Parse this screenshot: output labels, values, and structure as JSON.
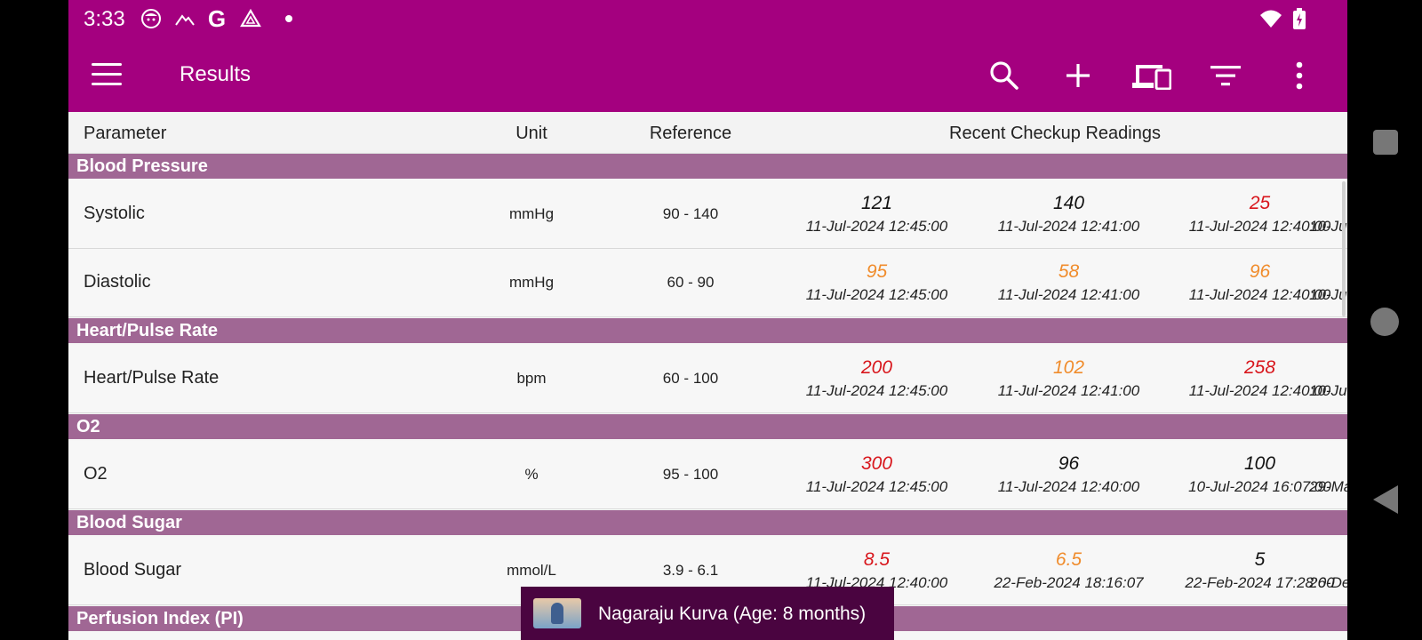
{
  "status": {
    "time": "3:33"
  },
  "toolbar": {
    "title": "Results"
  },
  "columns": {
    "parameter": "Parameter",
    "unit": "Unit",
    "reference": "Reference",
    "readings": "Recent Checkup Readings"
  },
  "sections": [
    {
      "name": "Blood Pressure"
    },
    {
      "name": "Heart/Pulse Rate"
    },
    {
      "name": "O2"
    },
    {
      "name": "Blood Sugar"
    },
    {
      "name": "Perfusion Index (PI)"
    }
  ],
  "rows": [
    {
      "param": "Systolic",
      "unit": "mmHg",
      "ref": "90 - 140",
      "readings": [
        {
          "value": "121",
          "date": "11-Jul-2024 12:45:00",
          "color": "#111111"
        },
        {
          "value": "140",
          "date": "11-Jul-2024 12:41:00",
          "color": "#111111"
        },
        {
          "value": "25",
          "date": "11-Jul-2024 12:40:00",
          "color": "#d8161c"
        },
        {
          "value": "",
          "date": "10-Ju",
          "color": "#111111"
        }
      ]
    },
    {
      "param": "Diastolic",
      "unit": "mmHg",
      "ref": "60 - 90",
      "readings": [
        {
          "value": "95",
          "date": "11-Jul-2024 12:45:00",
          "color": "#f08c2c"
        },
        {
          "value": "58",
          "date": "11-Jul-2024 12:41:00",
          "color": "#f08c2c"
        },
        {
          "value": "96",
          "date": "11-Jul-2024 12:40:00",
          "color": "#f08c2c"
        },
        {
          "value": "",
          "date": "10-Ju",
          "color": "#111111"
        }
      ]
    },
    {
      "param": "Heart/Pulse Rate",
      "unit": "bpm",
      "ref": "60 - 100",
      "readings": [
        {
          "value": "200",
          "date": "11-Jul-2024 12:45:00",
          "color": "#d8161c"
        },
        {
          "value": "102",
          "date": "11-Jul-2024 12:41:00",
          "color": "#f08c2c"
        },
        {
          "value": "258",
          "date": "11-Jul-2024 12:40:00",
          "color": "#d8161c"
        },
        {
          "value": "",
          "date": "10-Ju",
          "color": "#111111"
        }
      ]
    },
    {
      "param": "O2",
      "unit": "%",
      "ref": "95 - 100",
      "readings": [
        {
          "value": "300",
          "date": "11-Jul-2024 12:45:00",
          "color": "#d8161c"
        },
        {
          "value": "96",
          "date": "11-Jul-2024 12:40:00",
          "color": "#111111"
        },
        {
          "value": "100",
          "date": "10-Jul-2024 16:07:00",
          "color": "#111111"
        },
        {
          "value": "",
          "date": "29-Ma",
          "color": "#111111"
        }
      ]
    },
    {
      "param": "Blood Sugar",
      "unit": "mmol/L",
      "ref": "3.9 - 6.1",
      "readings": [
        {
          "value": "8.5",
          "date": "11-Jul-2024 12:40:00",
          "color": "#d8161c"
        },
        {
          "value": "6.5",
          "date": "22-Feb-2024 18:16:07",
          "color": "#f08c2c"
        },
        {
          "value": "5",
          "date": "22-Feb-2024 17:28:00",
          "color": "#111111"
        },
        {
          "value": "",
          "date": "26-De",
          "color": "#111111"
        }
      ]
    }
  ],
  "snackbar": {
    "text": "Nagaraju Kurva (Age: 8 months)"
  },
  "colors": {
    "primary": "#a4007f",
    "section": "#a06794",
    "high": "#d8161c",
    "warn": "#f08c2c"
  }
}
